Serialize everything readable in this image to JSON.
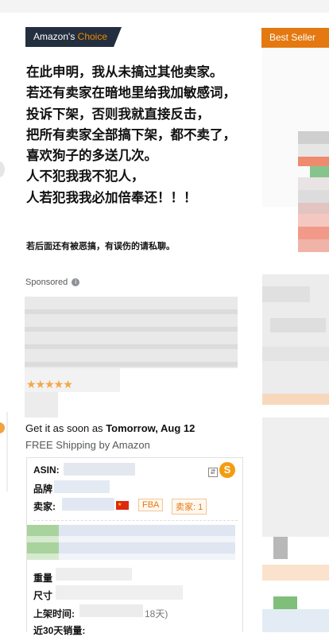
{
  "badges": {
    "choice_prefix": "Amazon's",
    "choice_accent": "Choice",
    "best_seller": "Best Seller"
  },
  "notice": {
    "lines": [
      "在此申明，我从未搞过其他卖家。",
      "若还有卖家在暗地里给我加敏感词，",
      "投诉下架，否则我就直接反击，",
      "把所有卖家全部搞下架，都不卖了，",
      "喜欢狗子的多送几次。",
      "人不犯我我不犯人，",
      "人若犯我我必加倍奉还！！！"
    ],
    "footnote": "若后面还有被恶搞，有误伤的请私聊。"
  },
  "product": {
    "sponsored": "Sponsored",
    "info_icon": "i",
    "stars": "★★★★★",
    "delivery_prefix": "Get it as soon as",
    "delivery_date": "Tomorrow, Aug 12",
    "shipping": "FREE Shipping by Amazon"
  },
  "seller_card": {
    "asin_label": "ASIN:",
    "brand_label": "品牌",
    "seller_label": "卖家:",
    "fba_tag": "FBA",
    "sellers_tag": "卖家: 1",
    "weight_label": "重量",
    "size_label": "尺寸",
    "listed_label": "上架时间:",
    "listed_days": "18天)",
    "sales_label": "近30天销量:",
    "logo_letter": "S",
    "tool_glyph": "⇵"
  },
  "colors": {
    "choice_bg": "#232f3e",
    "choice_accent": "#f08804",
    "best_seller_bg": "#e47911",
    "star": "#f3a847",
    "fba_tag": "#e47911"
  }
}
